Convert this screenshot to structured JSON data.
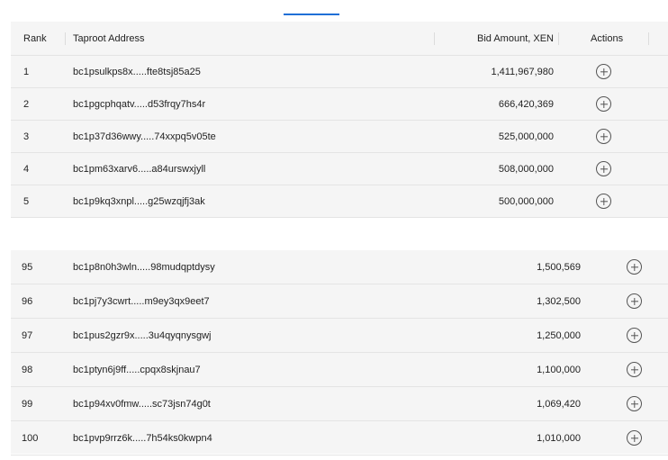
{
  "headers": {
    "rank": "Rank",
    "address": "Taproot Address",
    "amount": "Bid Amount, XEN",
    "actions": "Actions"
  },
  "top_rows": [
    {
      "rank": "1",
      "address": "bc1psulkps8x.....fte8tsj85a25",
      "amount": "1,411,967,980"
    },
    {
      "rank": "2",
      "address": "bc1pgcphqatv.....d53frqy7hs4r",
      "amount": "666,420,369"
    },
    {
      "rank": "3",
      "address": "bc1p37d36wwy.....74xxpq5v05te",
      "amount": "525,000,000"
    },
    {
      "rank": "4",
      "address": "bc1pm63xarv6.....a84urswxjyll",
      "amount": "508,000,000"
    },
    {
      "rank": "5",
      "address": "bc1p9kq3xnpl.....g25wzqjfj3ak",
      "amount": "500,000,000"
    }
  ],
  "bottom_rows": [
    {
      "rank": "95",
      "address": "bc1p8n0h3wln.....98mudqptdysy",
      "amount": "1,500,569"
    },
    {
      "rank": "96",
      "address": "bc1pj7y3cwrt.....m9ey3qx9eet7",
      "amount": "1,302,500"
    },
    {
      "rank": "97",
      "address": "bc1pus2gzr9x.....3u4qyqnysgwj",
      "amount": "1,250,000"
    },
    {
      "rank": "98",
      "address": "bc1ptyn6j9ff.....cpqx8skjnau7",
      "amount": "1,100,000"
    },
    {
      "rank": "99",
      "address": "bc1p94xv0fmw.....sc73jsn74g0t",
      "amount": "1,069,420"
    },
    {
      "rank": "100",
      "address": "bc1pvp9rrz6k.....7h54ks0kwpn4",
      "amount": "1,010,000"
    }
  ],
  "icons": {
    "action": "plus-circle-icon"
  },
  "colors": {
    "accent": "#1f6fd6",
    "table_bg": "#f5f5f5"
  }
}
